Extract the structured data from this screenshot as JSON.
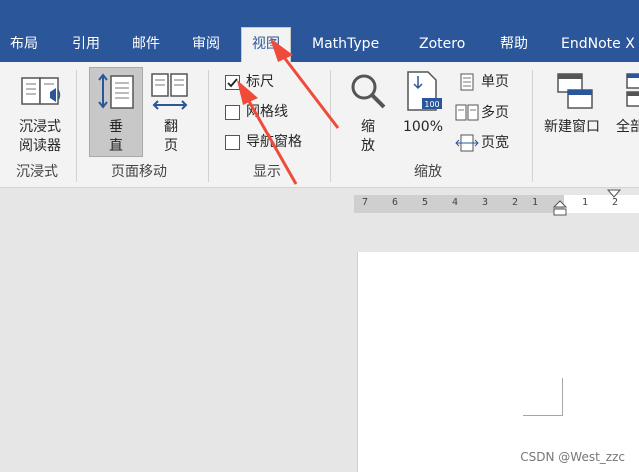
{
  "tabs": [
    {
      "label": "布局"
    },
    {
      "label": "引用"
    },
    {
      "label": "邮件"
    },
    {
      "label": "审阅"
    },
    {
      "label": "视图"
    },
    {
      "label": "MathType"
    },
    {
      "label": "Zotero"
    },
    {
      "label": "帮助"
    },
    {
      "label": "EndNote X"
    }
  ],
  "ribbon": {
    "immersive": {
      "btn_line1": "沉浸式",
      "btn_line2": "阅读器",
      "group": "沉浸式"
    },
    "page_move": {
      "vertical1": "垂",
      "vertical2": "直",
      "flip1": "翻",
      "flip2": "页",
      "group": "页面移动"
    },
    "show": {
      "ruler": "标尺",
      "ruler_checked": true,
      "gridlines": "网格线",
      "gridlines_checked": false,
      "nav": "导航窗格",
      "nav_checked": false,
      "group": "显示"
    },
    "zoom": {
      "zoom1": "缩",
      "zoom2": "放",
      "percent": "100%",
      "single": "单页",
      "multi": "多页",
      "width": "页宽",
      "group": "缩放",
      "badge": "100"
    },
    "window": {
      "new_window": "新建窗口",
      "all": "全部"
    }
  },
  "ruler": {
    "ticks_left": [
      "7",
      "6",
      "5",
      "4",
      "3",
      "2",
      "1"
    ],
    "ticks_right": [
      "1",
      "2"
    ]
  },
  "watermark": "CSDN @West_zzc",
  "colors": {
    "accent": "#2b579a",
    "arrow": "#f04a3a"
  }
}
